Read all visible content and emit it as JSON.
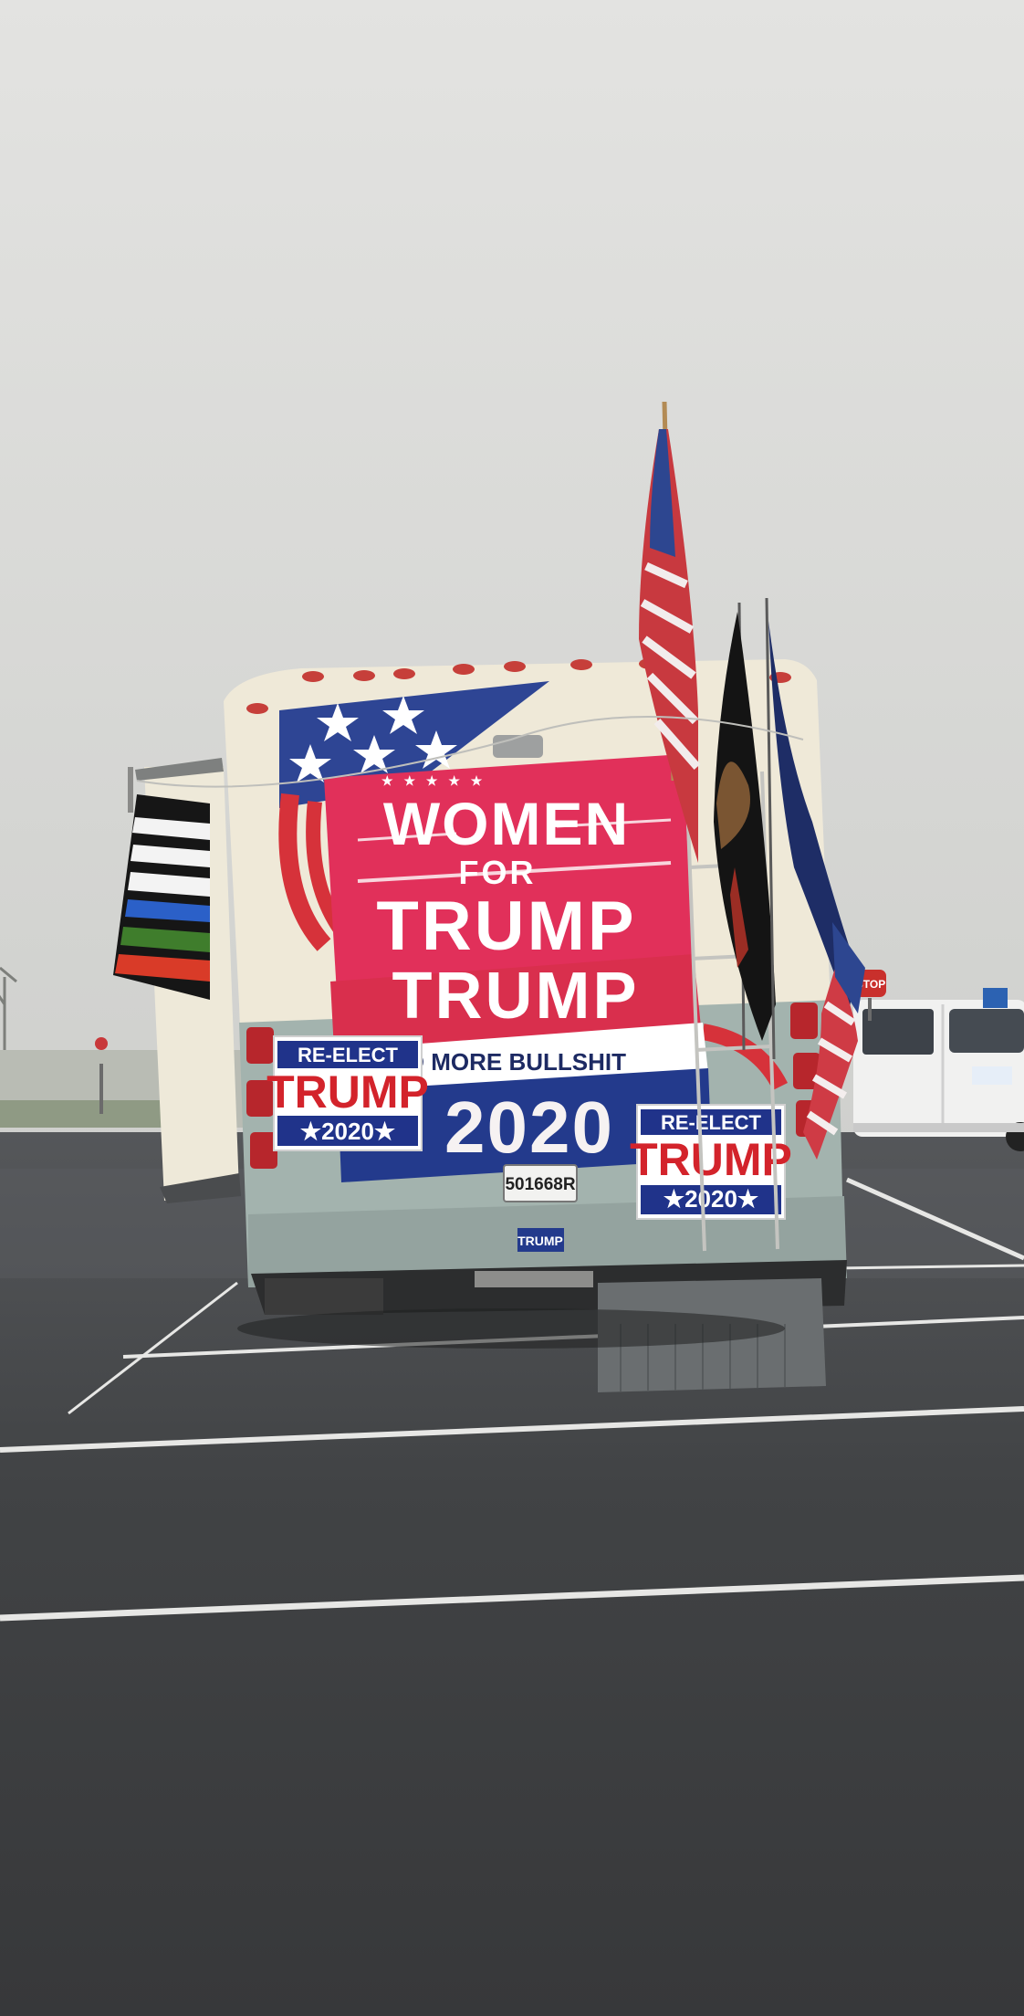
{
  "banner": {
    "line1": "WOMEN",
    "line2": "FOR",
    "line3": "TRUMP",
    "line4": "TRUMP",
    "line5": "NO MORE BULLSHIT",
    "line6": "2020"
  },
  "sign_left": {
    "top": "RE-ELECT",
    "middle": "TRUMP",
    "bottom": "★2020★"
  },
  "sign_right": {
    "top": "RE-ELECT",
    "middle": "TRUMP",
    "bottom": "★2020★"
  },
  "license_plate": "501668R",
  "bumper_sticker": "TRUMP",
  "stop_sign_right": "STOP",
  "colors": {
    "sky": "#d9d9d7",
    "asphalt": "#3e3f41",
    "rv_body": "#ece6d6",
    "rv_lower": "#9fb0ab",
    "banner_pink": "#e1305a",
    "flag_blue": "#233a8c",
    "sign_red": "#d3232b"
  }
}
